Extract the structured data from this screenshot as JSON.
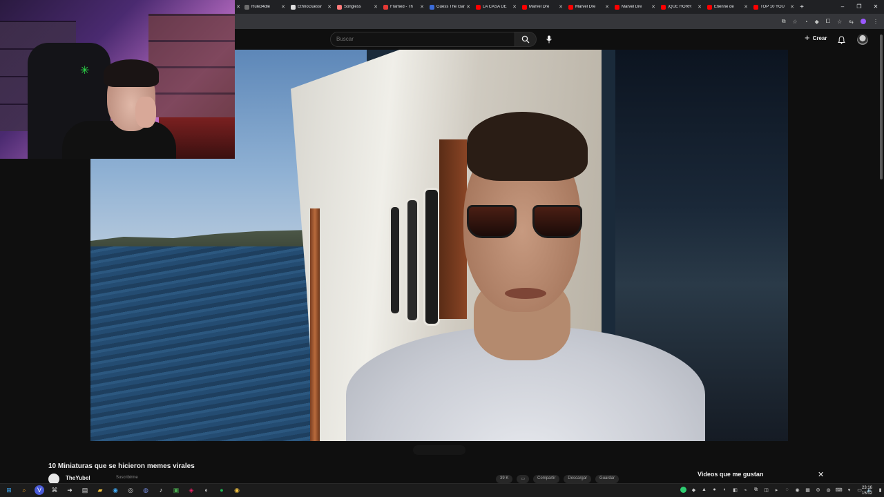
{
  "browser": {
    "tabs": [
      {
        "title": "Rule34dle",
        "color": "#6d6d6d"
      },
      {
        "title": "EthnoGuessr",
        "color": "#dddddd"
      },
      {
        "title": "Songless",
        "color": "#ff7a7a"
      },
      {
        "title": "Framed - Th",
        "color": "#e53935"
      },
      {
        "title": "Guess The Game",
        "color": "#3a6bd8"
      },
      {
        "title": "LA CASA DE",
        "color": "#ff0000"
      },
      {
        "title": "Marvel Dre",
        "color": "#ff0000"
      },
      {
        "title": "Marvel Dre",
        "color": "#ff0000"
      },
      {
        "title": "Marvel Dre",
        "color": "#ff0000"
      },
      {
        "title": "¡QUE HORR",
        "color": "#ff0000"
      },
      {
        "title": "Etienne de",
        "color": "#ff0000"
      },
      {
        "title": "TOP 10 YOU",
        "color": "#ff0000"
      }
    ],
    "new_tab": "+",
    "window_controls": [
      "–",
      "❐",
      "✕"
    ]
  },
  "youtube": {
    "search_placeholder": "Buscar",
    "create_label": "Crear",
    "video_title": "10 Miniaturas que se hicieron memes virales",
    "channel_name": "TheYubel",
    "subscribe_label": "Suscribirme",
    "actions": [
      "39 K",
      "",
      "Compartir",
      "Descargar",
      "Guardar"
    ],
    "liked_panel_title": "Videos que me gustan"
  },
  "taskbar": {
    "time": "23:16",
    "date": "15/12"
  },
  "colors": {
    "page_bg": "#0f0f0f",
    "chrome_tabstrip": "#202124",
    "chrome_toolbar": "#35363a",
    "accent_purple": "#9b59ff"
  }
}
